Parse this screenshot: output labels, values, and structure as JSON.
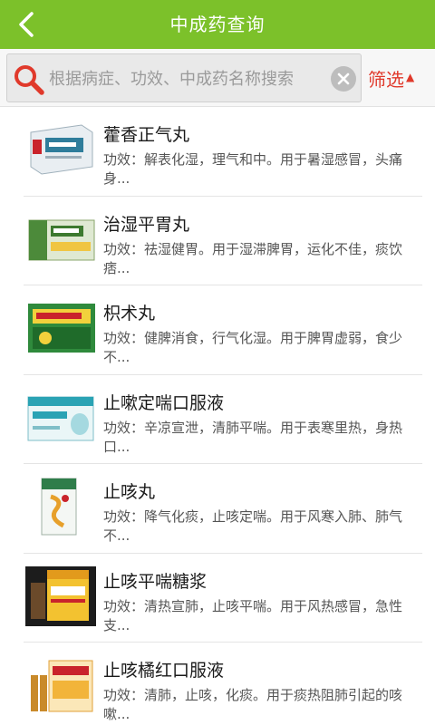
{
  "header": {
    "title": "中成药查询",
    "back_icon": "back-arrow-icon"
  },
  "search": {
    "placeholder": "根据病症、功效、中成药名称搜索",
    "value": "",
    "filter_label": "筛选",
    "filter_arrow": "▲"
  },
  "colors": {
    "header_bg": "#7cc12a",
    "filter_text": "#e0392b"
  },
  "items": [
    {
      "name": "藿香正气丸",
      "desc": "功效：解表化湿，理气和中。用于暑湿感冒，头痛身..."
    },
    {
      "name": "治湿平胃丸",
      "desc": "功效：祛湿健胃。用于湿滞脾胃，运化不佳，痰饮痞..."
    },
    {
      "name": "枳术丸",
      "desc": "功效：健脾消食，行气化湿。用于脾胃虚弱，食少不..."
    },
    {
      "name": "止嗽定喘口服液",
      "desc": "功效：辛凉宣泄，清肺平喘。用于表寒里热，身热口..."
    },
    {
      "name": "止咳丸",
      "desc": "功效：降气化痰，止咳定喘。用于风寒入肺、肺气不..."
    },
    {
      "name": "止咳平喘糖浆",
      "desc": "功效：清热宣肺，止咳平喘。用于风热感冒，急性支..."
    },
    {
      "name": "止咳橘红口服液",
      "desc": "功效：清肺，止咳，化痰。用于痰热阻肺引起的咳嗽..."
    }
  ]
}
